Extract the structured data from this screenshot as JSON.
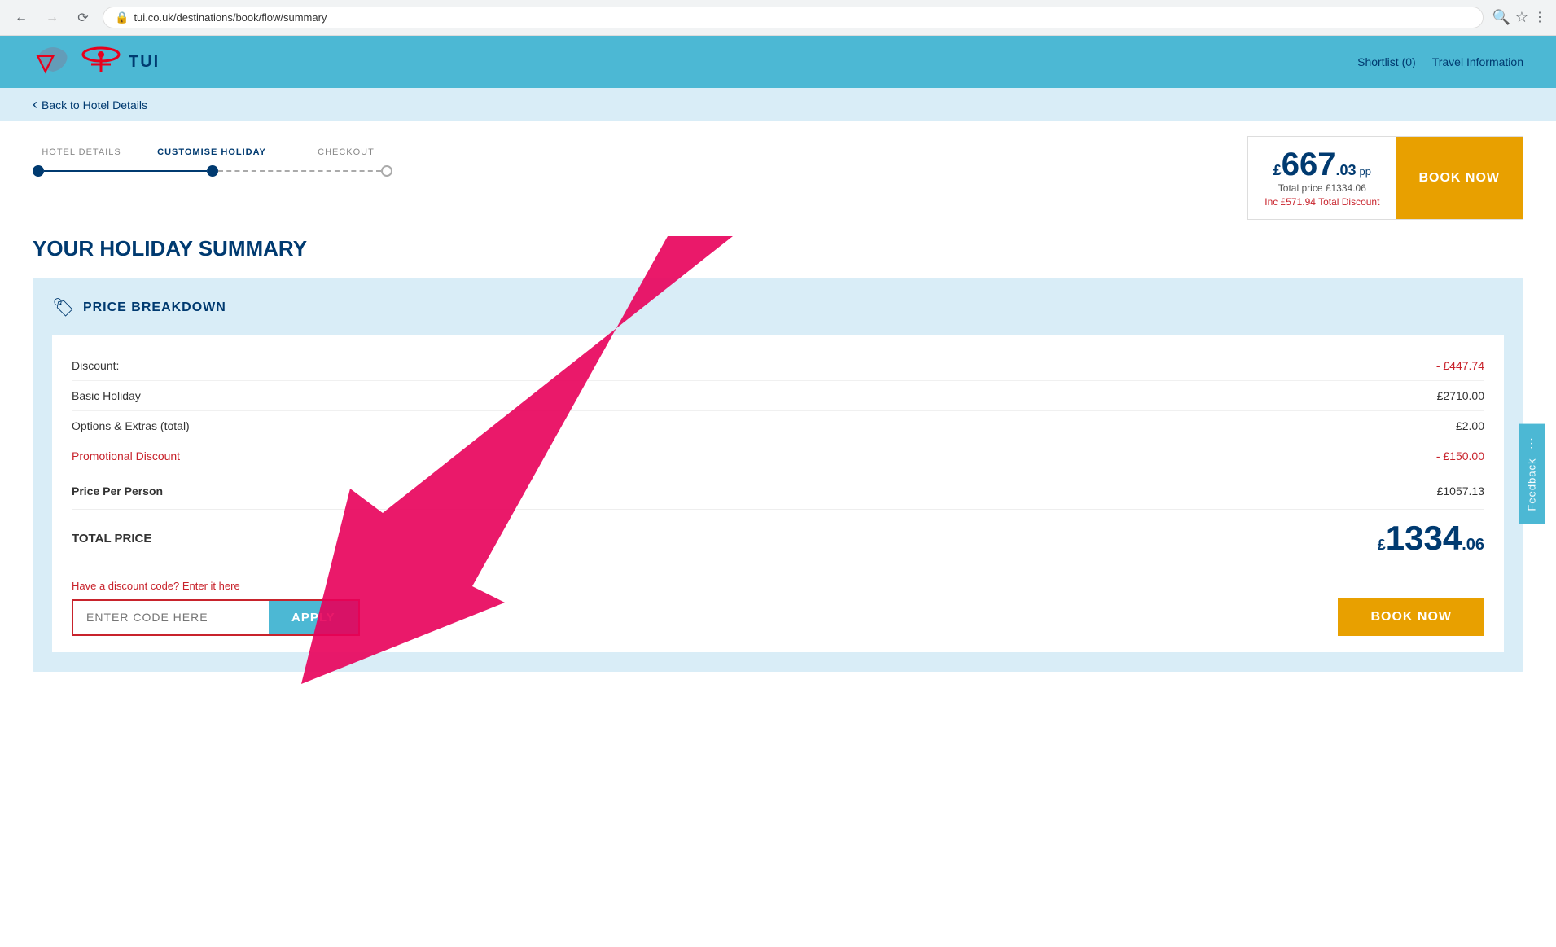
{
  "browser": {
    "url": "tui.co.uk/destinations/book/flow/summary",
    "back_disabled": false,
    "forward_disabled": false
  },
  "header": {
    "logo_text": "TUI",
    "shortlist_label": "Shortlist (0)",
    "travel_info_label": "Travel Information"
  },
  "sub_header": {
    "back_label": "Back to Hotel Details"
  },
  "steps": {
    "hotel_details": "HOTEL DETAILS",
    "customise_holiday": "CUSTOMISE HOLIDAY",
    "checkout": "CHECKOUT"
  },
  "price_box": {
    "currency": "£",
    "main": "667",
    "decimal": ".03",
    "pp": "pp",
    "total_label": "Total price £1334.06",
    "discount_label": "Inc £571.94 Total Discount",
    "book_now": "BOOK NOW"
  },
  "page_title": "YOUR HOLIDAY SUMMARY",
  "price_breakdown": {
    "section_title": "PRICE BREAKDOWN",
    "rows": [
      {
        "label": "Discount:",
        "value": "- £447.74",
        "red": true
      },
      {
        "label": "Basic Holiday",
        "value": "£2710.00",
        "red": false
      },
      {
        "label": "Options & Extras (total)",
        "value": "£2.00",
        "red": false
      },
      {
        "label": "Promotional Discount",
        "value": "- £150.00",
        "red": true,
        "promo": true
      }
    ],
    "price_per_person_label": "Price Per Person",
    "price_per_person_value": "£1057.13",
    "total_label": "TOTAL PRICE",
    "total_currency": "£",
    "total_main": "1334",
    "total_decimal": ".06"
  },
  "discount_code": {
    "label": "Have a discount code? Enter it here",
    "placeholder": "ENTER CODE HERE",
    "apply_label": "APPLY",
    "book_now_label": "BOOK NOW"
  },
  "feedback": {
    "label": "Feedback"
  }
}
